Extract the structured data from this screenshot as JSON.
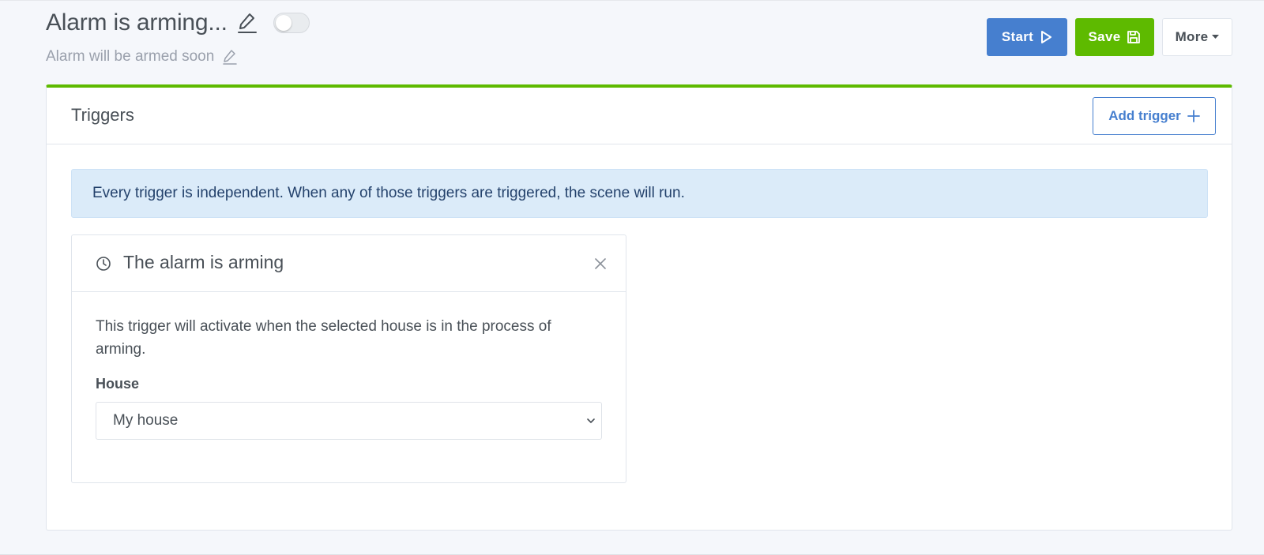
{
  "header": {
    "title": "Alarm is arming...",
    "subtitle": "Alarm will be armed soon",
    "toggle_on": false
  },
  "toolbar": {
    "start_label": "Start",
    "save_label": "Save",
    "more_label": "More"
  },
  "triggers": {
    "title": "Triggers",
    "add_label": "Add trigger",
    "info": "Every trigger is independent. When any of those triggers are triggered, the scene will run.",
    "items": [
      {
        "icon": "clock-icon",
        "title": "The alarm is arming",
        "description": "This trigger will activate when the selected house is in the process of arming.",
        "field_label": "House",
        "field_value": "My house"
      }
    ]
  },
  "colors": {
    "primary": "#467fcf",
    "success": "#5eba00",
    "info_bg": "#dbebf9"
  }
}
